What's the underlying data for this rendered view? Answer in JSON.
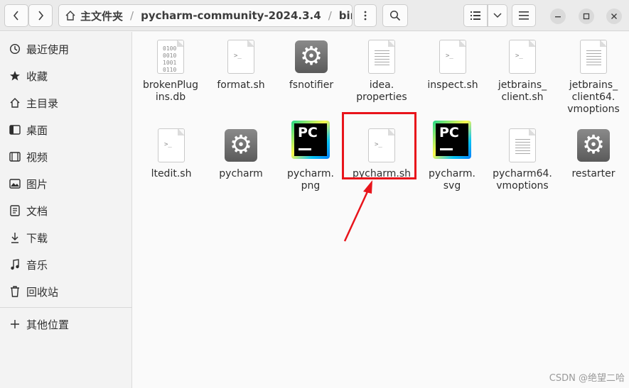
{
  "header": {
    "path": [
      "主文件夹",
      "pycharm-community-2024.3.4",
      "bin"
    ]
  },
  "sidebar": {
    "items": [
      {
        "label": "最近使用",
        "icon": "clock-icon"
      },
      {
        "label": "收藏",
        "icon": "star-icon"
      },
      {
        "label": "主目录",
        "icon": "home-icon"
      },
      {
        "label": "桌面",
        "icon": "desktop-icon"
      },
      {
        "label": "视频",
        "icon": "video-icon"
      },
      {
        "label": "图片",
        "icon": "image-icon"
      },
      {
        "label": "文档",
        "icon": "document-icon"
      },
      {
        "label": "下载",
        "icon": "download-icon"
      },
      {
        "label": "音乐",
        "icon": "music-icon"
      },
      {
        "label": "回收站",
        "icon": "trash-icon"
      }
    ],
    "other": "其他位置"
  },
  "files": [
    {
      "name": "brokenPlug\nins.db",
      "type": "binary"
    },
    {
      "name": "format.sh",
      "type": "script"
    },
    {
      "name": "fsnotifier",
      "type": "exec"
    },
    {
      "name": "idea.\nproperties",
      "type": "text"
    },
    {
      "name": "inspect.sh",
      "type": "script"
    },
    {
      "name": "jetbrains_\nclient.sh",
      "type": "script"
    },
    {
      "name": "jetbrains_\nclient64.\nvmoptions",
      "type": "text"
    },
    {
      "name": "ltedit.sh",
      "type": "script"
    },
    {
      "name": "pycharm",
      "type": "exec"
    },
    {
      "name": "pycharm.\npng",
      "type": "pc"
    },
    {
      "name": "pycharm.sh",
      "type": "script"
    },
    {
      "name": "pycharm.\nsvg",
      "type": "pc"
    },
    {
      "name": "pycharm64.\nvmoptions",
      "type": "text"
    },
    {
      "name": "restarter",
      "type": "exec"
    }
  ],
  "icon_text": {
    "term": ">_",
    "pc": "PC",
    "bin": "0100\n0010\n1001\n0110"
  },
  "watermark": "CSDN @绝望二哈",
  "colors": {
    "highlight": "#e8141b",
    "arrow": "#e8141b"
  }
}
